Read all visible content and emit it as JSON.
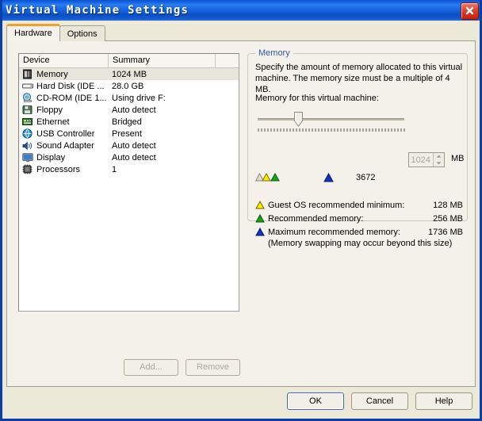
{
  "window": {
    "title": "Virtual Machine Settings",
    "close_icon": "close-icon"
  },
  "tabs": [
    {
      "label": "Hardware",
      "active": true
    },
    {
      "label": "Options",
      "active": false
    }
  ],
  "device_list": {
    "columns": [
      "Device",
      "Summary",
      ""
    ],
    "rows": [
      {
        "icon": "memory-icon",
        "device": "Memory",
        "summary": "1024 MB",
        "selected": true
      },
      {
        "icon": "harddisk-icon",
        "device": "Hard Disk (IDE ...",
        "summary": "28.0 GB",
        "selected": false
      },
      {
        "icon": "cdrom-icon",
        "device": "CD-ROM (IDE 1...",
        "summary": "Using drive F:",
        "selected": false
      },
      {
        "icon": "floppy-icon",
        "device": "Floppy",
        "summary": "Auto detect",
        "selected": false
      },
      {
        "icon": "ethernet-icon",
        "device": "Ethernet",
        "summary": "Bridged",
        "selected": false
      },
      {
        "icon": "usb-icon",
        "device": "USB Controller",
        "summary": "Present",
        "selected": false
      },
      {
        "icon": "sound-icon",
        "device": "Sound Adapter",
        "summary": "Auto detect",
        "selected": false
      },
      {
        "icon": "display-icon",
        "device": "Display",
        "summary": "Auto detect",
        "selected": false
      },
      {
        "icon": "processor-icon",
        "device": "Processors",
        "summary": "1",
        "selected": false
      }
    ]
  },
  "list_buttons": {
    "add_label": "Add...",
    "remove_label": "Remove"
  },
  "memory": {
    "group_title": "Memory",
    "description": "Specify the amount of memory allocated to this virtual machine. The memory size must be a multiple of 4 MB.",
    "slider_label": "Memory for this virtual machine:",
    "value": "1024",
    "unit": "MB",
    "slider_percent": 28,
    "max_scale_label": "3672",
    "legend": [
      {
        "marker": "triangle-yellow",
        "label": "Guest OS recommended minimum:",
        "value": "128 MB",
        "color": "#ffe000"
      },
      {
        "marker": "triangle-green",
        "label": "Recommended memory:",
        "value": "256 MB",
        "color": "#19a11e"
      },
      {
        "marker": "triangle-blue",
        "label": "Maximum recommended memory:",
        "value": "1736 MB",
        "color": "#1033c0"
      }
    ],
    "legend_note": "(Memory swapping may occur beyond this size)"
  },
  "dialog_buttons": {
    "ok": "OK",
    "cancel": "Cancel",
    "help": "Help"
  },
  "colors": {
    "titlebar_blue": "#0a52cf",
    "window_border": "#0a3fa8",
    "face": "#ece9d8",
    "tab_active_accent": "#f0a030",
    "group_title": "#2b5ba8",
    "selection": "#e8e6dc"
  }
}
